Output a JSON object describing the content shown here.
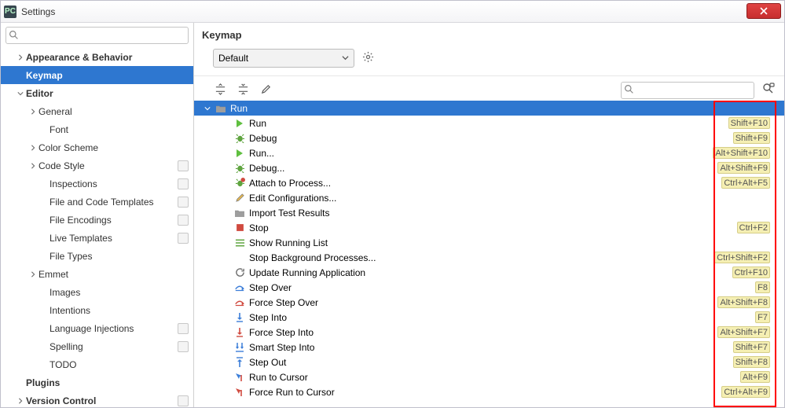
{
  "window": {
    "title": "Settings"
  },
  "main": {
    "title": "Keymap"
  },
  "scheme": {
    "selected": "Default"
  },
  "sidebar": {
    "items": [
      {
        "label": "Appearance & Behavior",
        "level": 1,
        "bold": true,
        "arrow": "right",
        "badge": false,
        "selected": false
      },
      {
        "label": "Keymap",
        "level": 1,
        "bold": true,
        "arrow": "none",
        "badge": false,
        "selected": true
      },
      {
        "label": "Editor",
        "level": 1,
        "bold": true,
        "arrow": "down",
        "badge": false,
        "selected": false
      },
      {
        "label": "General",
        "level": 2,
        "bold": false,
        "arrow": "right",
        "badge": false,
        "selected": false
      },
      {
        "label": "Font",
        "level": 3,
        "bold": false,
        "arrow": "none",
        "badge": false,
        "selected": false
      },
      {
        "label": "Color Scheme",
        "level": 2,
        "bold": false,
        "arrow": "right",
        "badge": false,
        "selected": false
      },
      {
        "label": "Code Style",
        "level": 2,
        "bold": false,
        "arrow": "right",
        "badge": true,
        "selected": false
      },
      {
        "label": "Inspections",
        "level": 3,
        "bold": false,
        "arrow": "none",
        "badge": true,
        "selected": false
      },
      {
        "label": "File and Code Templates",
        "level": 3,
        "bold": false,
        "arrow": "none",
        "badge": true,
        "selected": false
      },
      {
        "label": "File Encodings",
        "level": 3,
        "bold": false,
        "arrow": "none",
        "badge": true,
        "selected": false
      },
      {
        "label": "Live Templates",
        "level": 3,
        "bold": false,
        "arrow": "none",
        "badge": true,
        "selected": false
      },
      {
        "label": "File Types",
        "level": 3,
        "bold": false,
        "arrow": "none",
        "badge": false,
        "selected": false
      },
      {
        "label": "Emmet",
        "level": 2,
        "bold": false,
        "arrow": "right",
        "badge": false,
        "selected": false
      },
      {
        "label": "Images",
        "level": 3,
        "bold": false,
        "arrow": "none",
        "badge": false,
        "selected": false
      },
      {
        "label": "Intentions",
        "level": 3,
        "bold": false,
        "arrow": "none",
        "badge": false,
        "selected": false
      },
      {
        "label": "Language Injections",
        "level": 3,
        "bold": false,
        "arrow": "none",
        "badge": true,
        "selected": false
      },
      {
        "label": "Spelling",
        "level": 3,
        "bold": false,
        "arrow": "none",
        "badge": true,
        "selected": false
      },
      {
        "label": "TODO",
        "level": 3,
        "bold": false,
        "arrow": "none",
        "badge": false,
        "selected": false
      },
      {
        "label": "Plugins",
        "level": 1,
        "bold": true,
        "arrow": "none",
        "badge": false,
        "selected": false
      },
      {
        "label": "Version Control",
        "level": 1,
        "bold": true,
        "arrow": "right",
        "badge": true,
        "selected": false
      }
    ]
  },
  "keymap": {
    "category": "Run",
    "items": [
      {
        "icon": "play-green",
        "label": "Run",
        "shortcut": "Shift+F10"
      },
      {
        "icon": "bug-green",
        "label": "Debug",
        "shortcut": "Shift+F9"
      },
      {
        "icon": "play-green",
        "label": "Run...",
        "shortcut": "Alt+Shift+F10"
      },
      {
        "icon": "bug-green",
        "label": "Debug...",
        "shortcut": "Alt+Shift+F9"
      },
      {
        "icon": "bug-red",
        "label": "Attach to Process...",
        "shortcut": "Ctrl+Alt+F5"
      },
      {
        "icon": "pencil",
        "label": "Edit Configurations...",
        "shortcut": ""
      },
      {
        "icon": "folder",
        "label": "Import Test Results",
        "shortcut": ""
      },
      {
        "icon": "stop",
        "label": "Stop",
        "shortcut": "Ctrl+F2"
      },
      {
        "icon": "list",
        "label": "Show Running List",
        "shortcut": ""
      },
      {
        "icon": "none",
        "label": "Stop Background Processes...",
        "shortcut": "Ctrl+Shift+F2"
      },
      {
        "icon": "refresh",
        "label": "Update Running Application",
        "shortcut": "Ctrl+F10"
      },
      {
        "icon": "step-over-blue",
        "label": "Step Over",
        "shortcut": "F8"
      },
      {
        "icon": "step-over-red",
        "label": "Force Step Over",
        "shortcut": "Alt+Shift+F8"
      },
      {
        "icon": "step-into-blue",
        "label": "Step Into",
        "shortcut": "F7"
      },
      {
        "icon": "step-into-red",
        "label": "Force Step Into",
        "shortcut": "Alt+Shift+F7"
      },
      {
        "icon": "step-smart",
        "label": "Smart Step Into",
        "shortcut": "Shift+F7"
      },
      {
        "icon": "step-out",
        "label": "Step Out",
        "shortcut": "Shift+F8"
      },
      {
        "icon": "cursor-blue",
        "label": "Run to Cursor",
        "shortcut": "Alt+F9"
      },
      {
        "icon": "cursor-red",
        "label": "Force Run to Cursor",
        "shortcut": "Ctrl+Alt+F9"
      }
    ]
  }
}
